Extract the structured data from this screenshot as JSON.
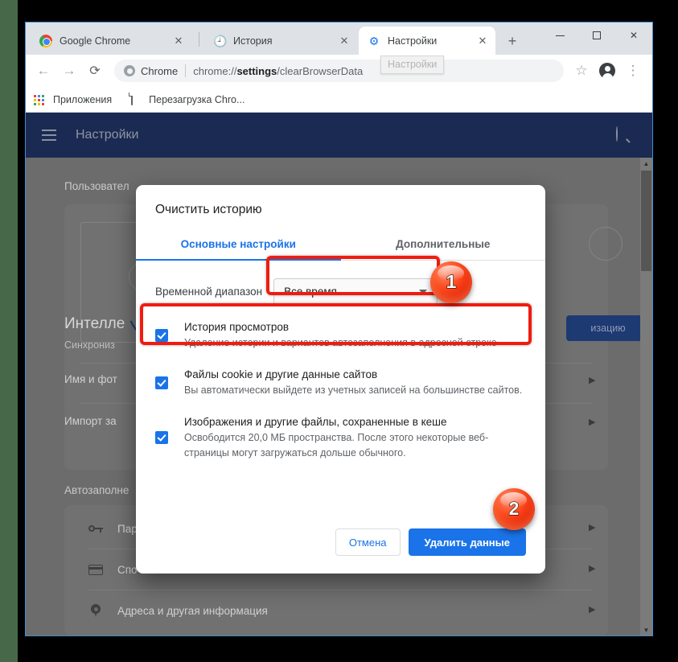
{
  "browser": {
    "tabs": [
      {
        "label": "Google Chrome",
        "icon": "chrome-logo-icon",
        "active": false
      },
      {
        "label": "История",
        "icon": "history-clock-icon",
        "active": false
      },
      {
        "label": "Настройки",
        "icon": "gear-icon",
        "active": true
      }
    ],
    "new_tab_label": "+",
    "tooltip": "Настройки",
    "window_controls": {
      "minimize": "–",
      "maximize": "□",
      "close": "✕"
    },
    "toolbar": {
      "back": "←",
      "forward": "→",
      "reload": "⟳",
      "omnibox_chip": "Chrome",
      "url_prefix": "chrome://",
      "url_bold": "settings",
      "url_suffix": "/clearBrowserData",
      "bookmark_star": "☆",
      "menu": "⋮"
    },
    "bookmarks": [
      {
        "label": "Приложения",
        "icon": "apps-grid-icon"
      },
      {
        "label": "Перезагрузка Chro...",
        "icon": "document-icon"
      }
    ]
  },
  "settings_page": {
    "header_title": "Настройки",
    "menu_icon": "hamburger-icon",
    "search_icon": "search-icon",
    "sections": [
      {
        "title": "Пользовател"
      },
      {
        "title": "Автозаполне"
      }
    ],
    "profile_card": {
      "heading": "Интелле",
      "subheading": "Синхрониз",
      "sync_button": "изацию",
      "rows": [
        "Имя и фот",
        "Импорт за"
      ]
    },
    "autofill_rows": [
      {
        "label": "Пар",
        "icon": "key-icon"
      },
      {
        "label": "Спо",
        "icon": "credit-card-icon"
      },
      {
        "label": "Адреса и другая информация",
        "icon": "location-pin-icon"
      }
    ],
    "row_arrow": "▶",
    "scrollbar": {
      "up": "▲",
      "down": "▼"
    }
  },
  "dialog": {
    "title": "Очистить историю",
    "tabs": [
      {
        "label": "Основные настройки",
        "selected": true
      },
      {
        "label": "Дополнительные",
        "selected": false
      }
    ],
    "time_range": {
      "label": "Временной диапазон",
      "value": "Все время",
      "caret_icon": "chevron-down-icon"
    },
    "checkboxes": [
      {
        "title": "История просмотров",
        "description": "Удаление истории и вариантов автозаполнения в адресной строке",
        "checked": true
      },
      {
        "title": "Файлы cookie и другие данные сайтов",
        "description": "Вы автоматически выйдете из учетных записей на большинстве сайтов.",
        "checked": true
      },
      {
        "title": "Изображения и другие файлы, сохраненные в кеше",
        "description": "Освободится 20,0 МБ пространства. После этого некоторые веб-страницы могут загружаться дольше обычного.",
        "checked": true
      }
    ],
    "buttons": {
      "cancel": "Отмена",
      "confirm": "Удалить данные"
    }
  },
  "annotations": {
    "badges": [
      {
        "number": "1"
      },
      {
        "number": "2"
      }
    ],
    "highlight_color": "#f01c0f",
    "badge_color": "#e41f05"
  },
  "theme": {
    "accent_blue": "#1a73e8",
    "header_blue": "#1b2a52",
    "tabstrip_gray": "#dee1e6",
    "dim_gray": "#6c6c6c"
  }
}
